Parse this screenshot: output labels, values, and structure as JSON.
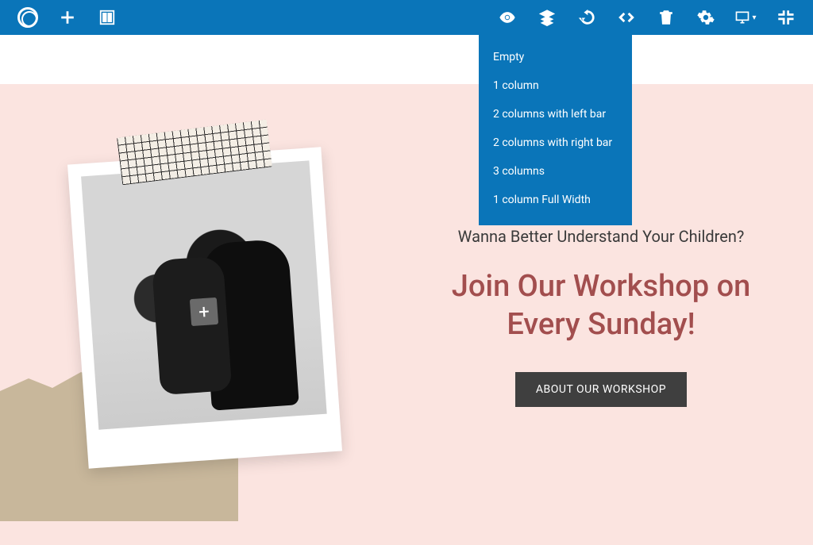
{
  "toolbar": {
    "icons": {
      "logo": "logo",
      "add": "plus",
      "layout": "layout",
      "preview": "eye",
      "layers": "layers",
      "history": "history",
      "code": "code",
      "delete": "trash",
      "settings": "gear",
      "device": "monitor",
      "fullscreen": "collapse"
    }
  },
  "dropdown": {
    "items": [
      "Empty",
      "1 column",
      "2 columns with left bar",
      "2 columns with right bar",
      "3 columns",
      "1 column Full Width"
    ]
  },
  "content": {
    "subhead": "Wanna Better Understand Your Children?",
    "headline_line1": "Join Our Workshop on",
    "headline_line2": "Every Sunday!",
    "cta": "ABOUT OUR WORKSHOP"
  },
  "editor": {
    "add_block": "+"
  }
}
